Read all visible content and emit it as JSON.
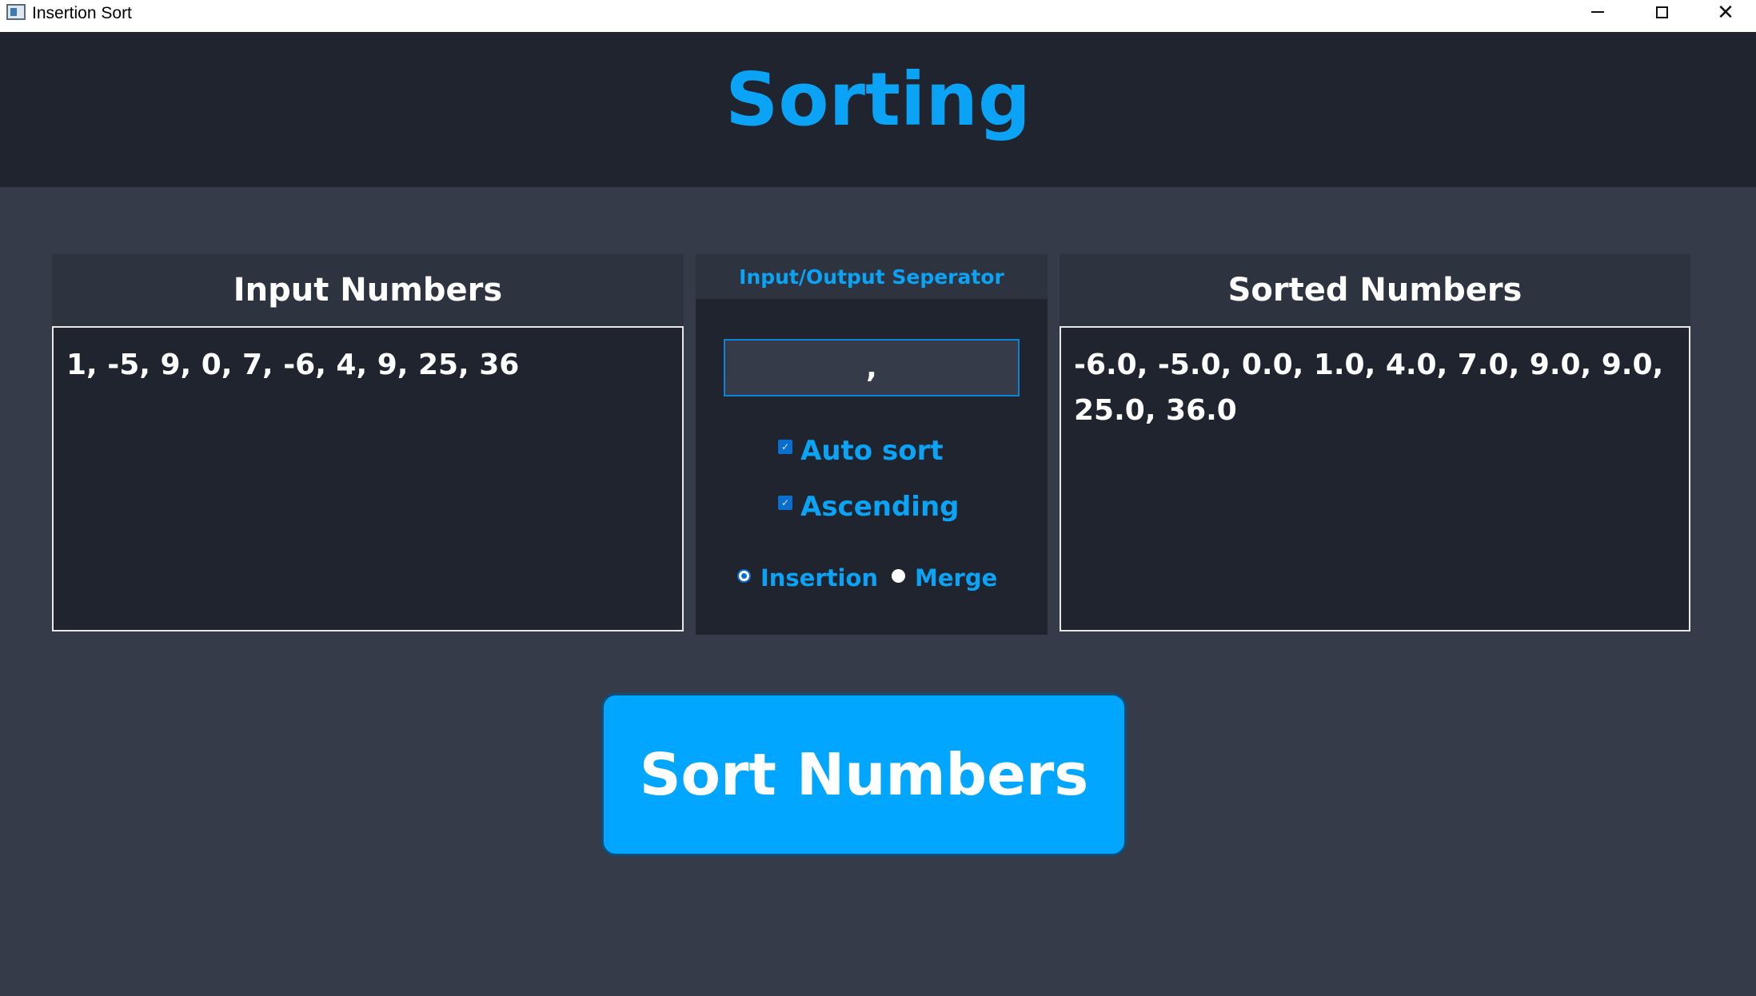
{
  "window": {
    "title": "Insertion Sort",
    "icon": "app-window-icon",
    "controls": {
      "minimize": "minimize-icon",
      "maximize": "maximize-icon",
      "close": "✕"
    }
  },
  "header": {
    "title": "Sorting"
  },
  "input_panel": {
    "heading": "Input Numbers",
    "value": "1, -5, 9, 0, 7, -6, 4, 9, 25, 36"
  },
  "options_panel": {
    "heading": "Input/Output Seperator",
    "separator_value": ",",
    "auto_sort": {
      "label": "Auto sort",
      "checked": true
    },
    "ascending": {
      "label": "Ascending",
      "checked": true
    },
    "algorithms": [
      {
        "label": "Insertion",
        "selected": true
      },
      {
        "label": "Merge",
        "selected": false
      }
    ]
  },
  "sorted_panel": {
    "heading": "Sorted Numbers",
    "value": "-6.0, -5.0, 0.0, 1.0, 4.0, 7.0, 9.0, 9.0, 25.0, 36.0"
  },
  "sort_button": {
    "label": "Sort Numbers"
  },
  "colors": {
    "accent": "#0aa3f5",
    "button": "#00a6ff",
    "header_bg": "#1f242e",
    "body_bg": "#363b4a"
  }
}
